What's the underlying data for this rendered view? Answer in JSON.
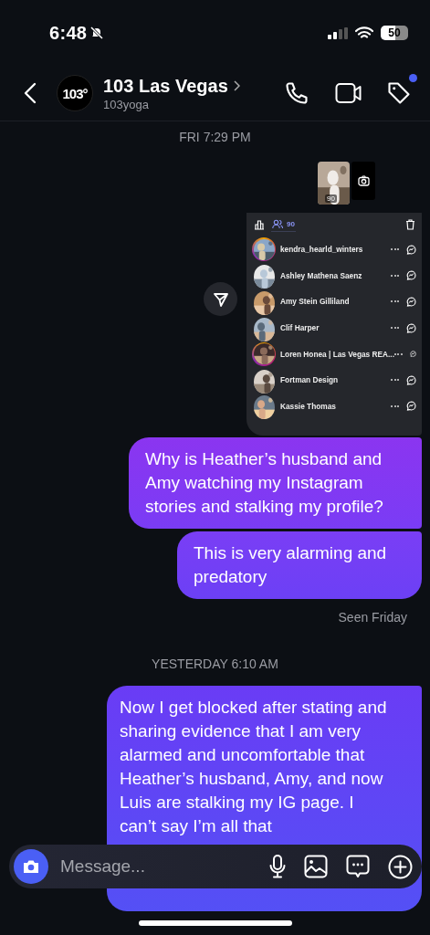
{
  "status_bar": {
    "time": "6:48",
    "battery": "50",
    "silent": true
  },
  "header": {
    "avatar_text": "103°",
    "name": "103 Las Vegas",
    "username": "103yoga",
    "tag_badge": true
  },
  "first_date": "FRI 7:29 PM",
  "story": {
    "views": "90",
    "viewer_tabs": [
      {
        "kind": "insights",
        "selected": false
      },
      {
        "kind": "viewers",
        "label": "90",
        "selected": true
      }
    ],
    "viewers": [
      {
        "name": "kendra_hearld_winters",
        "ring": true
      },
      {
        "name": "Ashley Mathena Saenz",
        "ring": false
      },
      {
        "name": "Amy Stein Gilliland",
        "ring": false
      },
      {
        "name": "Clif Harper",
        "ring": false
      },
      {
        "name": "Loren Honea | Las Vegas REA...",
        "ring": true
      },
      {
        "name": "Fortman Design",
        "ring": false
      },
      {
        "name": "Kassie Thomas",
        "ring": false
      }
    ]
  },
  "messages": [
    {
      "kind": "bubble",
      "text": "Why is Heather’s husband and Amy watching my Instagram stories and stalking my profile?"
    },
    {
      "kind": "bubble",
      "text": "This is very alarming and predatory"
    },
    {
      "kind": "seen",
      "text": "Seen Friday"
    },
    {
      "kind": "date",
      "text": "YESTERDAY 6:10 AM"
    },
    {
      "kind": "bubble",
      "text": "Now I get blocked after stating and sharing evidence that I am very alarmed and uncomfortable that Heather’s husband, Amy, and now Luis are stalking my IG page. I can’t say I’m all that"
    }
  ],
  "composer": {
    "placeholder": "Message..."
  }
}
